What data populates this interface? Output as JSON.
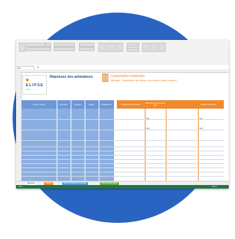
{
  "logo": {
    "name": "ELIPSE",
    "sub": "elipse.fr"
  },
  "sheet": {
    "title": "Réponses des animateurs",
    "course_title": "Coopérative maîtrisée",
    "course_subtitle": "Affichage - Présentation des travaux, suivi veille et pistes formation"
  },
  "formula_bar": {
    "cell": "A1",
    "fx": "fx"
  },
  "table": {
    "blue_headers": [
      "Projet / Activité",
      "Animateur",
      "Coéquipe",
      "Région",
      "Département"
    ],
    "orange_headers": [
      "Question de la formation",
      "Réflexions sur les points clés",
      "Critères de réussite"
    ],
    "orange_cells": {
      "yes1": "Oui",
      "no1": "Non",
      "yes2": "Oui",
      "no2": "Non"
    }
  },
  "tabs": [
    "Réponses",
    "Légende",
    "Fiche de réflexion de l'animateur",
    "Fiche formation action"
  ],
  "status": {
    "ready": "Prêt",
    "zoom": "100 %"
  }
}
